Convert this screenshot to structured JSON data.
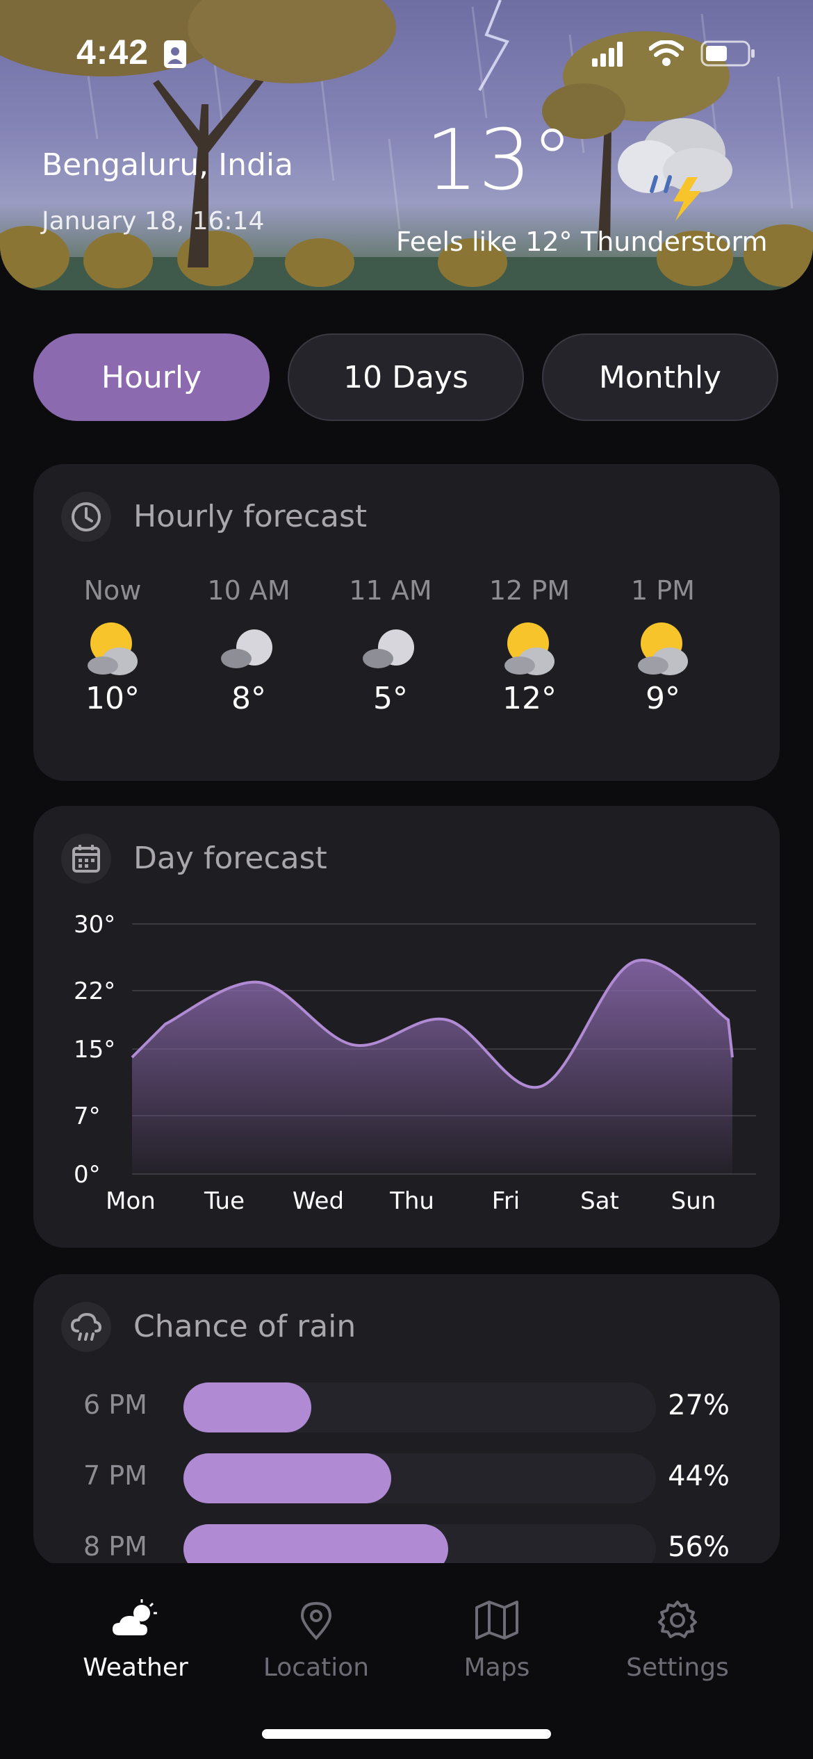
{
  "status_bar": {
    "time": "4:42"
  },
  "header": {
    "city": "Bengaluru, India",
    "date": "January 18, 16:14",
    "temperature": "13°",
    "feels_like": "Feels like 12°",
    "condition": "Thunderstorm",
    "condition_icon": "thunderstorm-icon"
  },
  "tabs": [
    {
      "label": "Hourly",
      "active": true
    },
    {
      "label": "10 Days",
      "active": false
    },
    {
      "label": "Monthly",
      "active": false
    }
  ],
  "hourly": {
    "title": "Hourly forecast",
    "items": [
      {
        "time": "Now",
        "temp": "10°",
        "icon": "partly-sunny-icon"
      },
      {
        "time": "10 AM",
        "temp": "8°",
        "icon": "cloudy-icon"
      },
      {
        "time": "11 AM",
        "temp": "5°",
        "icon": "cloudy-icon"
      },
      {
        "time": "12 PM",
        "temp": "12°",
        "icon": "partly-sunny-icon"
      },
      {
        "time": "1 PM",
        "temp": "9°",
        "icon": "partly-sunny-icon"
      }
    ]
  },
  "day_forecast": {
    "title": "Day forecast",
    "chart_data": {
      "type": "area",
      "categories": [
        "Mon",
        "Tue",
        "Wed",
        "Thu",
        "Fri",
        "Sat",
        "Sun"
      ],
      "values": [
        18,
        23,
        15.5,
        18.5,
        10.5,
        25.5,
        18.5
      ],
      "y_ticks": [
        "30°",
        "22°",
        "15°",
        "7°",
        "0°"
      ],
      "y_tick_values": [
        30,
        22,
        15,
        7,
        0
      ],
      "ylim": [
        0,
        30
      ],
      "grid": true,
      "color": "#b08bd4"
    }
  },
  "rain": {
    "title": "Chance of rain",
    "rows": [
      {
        "time": "6 PM",
        "value": "27%",
        "fraction": 0.27
      },
      {
        "time": "7 PM",
        "value": "44%",
        "fraction": 0.44
      },
      {
        "time": "8 PM",
        "value": "56%",
        "fraction": 0.56
      }
    ]
  },
  "nav": [
    {
      "label": "Weather",
      "icon": "weather-icon",
      "active": true
    },
    {
      "label": "Location",
      "icon": "location-pin-icon",
      "active": false
    },
    {
      "label": "Maps",
      "icon": "map-icon",
      "active": false
    },
    {
      "label": "Settings",
      "icon": "gear-icon",
      "active": false
    }
  ],
  "colors": {
    "accent": "#8c6aaf",
    "accent_light": "#b08bd4",
    "background": "#0c0c0e",
    "card": "#1e1d21"
  }
}
